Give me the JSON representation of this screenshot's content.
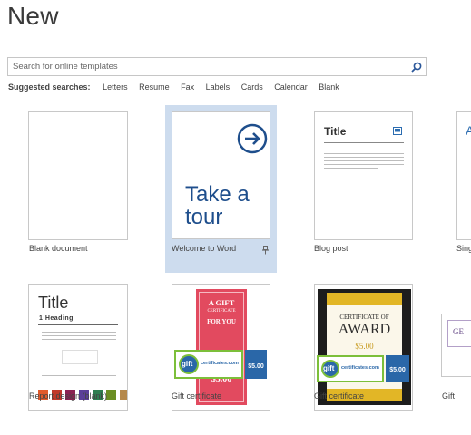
{
  "header": {
    "title": "New"
  },
  "search": {
    "placeholder": "Search for online templates"
  },
  "suggested": {
    "label": "Suggested searches:",
    "items": [
      "Letters",
      "Resume",
      "Fax",
      "Labels",
      "Cards",
      "Calendar",
      "Blank"
    ]
  },
  "templates": [
    {
      "label": "Blank document"
    },
    {
      "label": "Welcome to Word",
      "thumb_line1": "Take a",
      "thumb_line2": "tour"
    },
    {
      "label": "Blog post",
      "thumb_title": "Title"
    },
    {
      "label": "Sing"
    },
    {
      "label": "Report design (blank)",
      "thumb_title": "Title",
      "thumb_heading": "1  Heading"
    },
    {
      "label": "Gift certificate",
      "thumb_a": "A GIFT",
      "thumb_b": "CERTIFICATE",
      "thumb_c": "FOR YOU",
      "thumb_price": "$5.00",
      "thumb_brand": "certificates.com",
      "thumb_gift": "gift",
      "thumb_badge": "$5.00"
    },
    {
      "label": "Gift certificate",
      "thumb_a": "CERTIFICATE OF",
      "thumb_b": "AWARD",
      "thumb_price": "$5.00",
      "thumb_brand": "certificates.com",
      "thumb_gift": "gift",
      "thumb_badge": "$5.00"
    },
    {
      "label": "Gift"
    }
  ],
  "colors": {
    "accent": "#1e4e8c",
    "selected_bg": "#cddcee",
    "report_swatches": [
      "#e05a2b",
      "#c0392b",
      "#8b2252",
      "#5b3e99",
      "#2e7d4f",
      "#6b8e23",
      "#b5894c"
    ]
  },
  "icons": {
    "search": "search-icon",
    "arrow": "arrow-right-circle-icon",
    "pin": "pin-icon",
    "image": "image-icon"
  }
}
